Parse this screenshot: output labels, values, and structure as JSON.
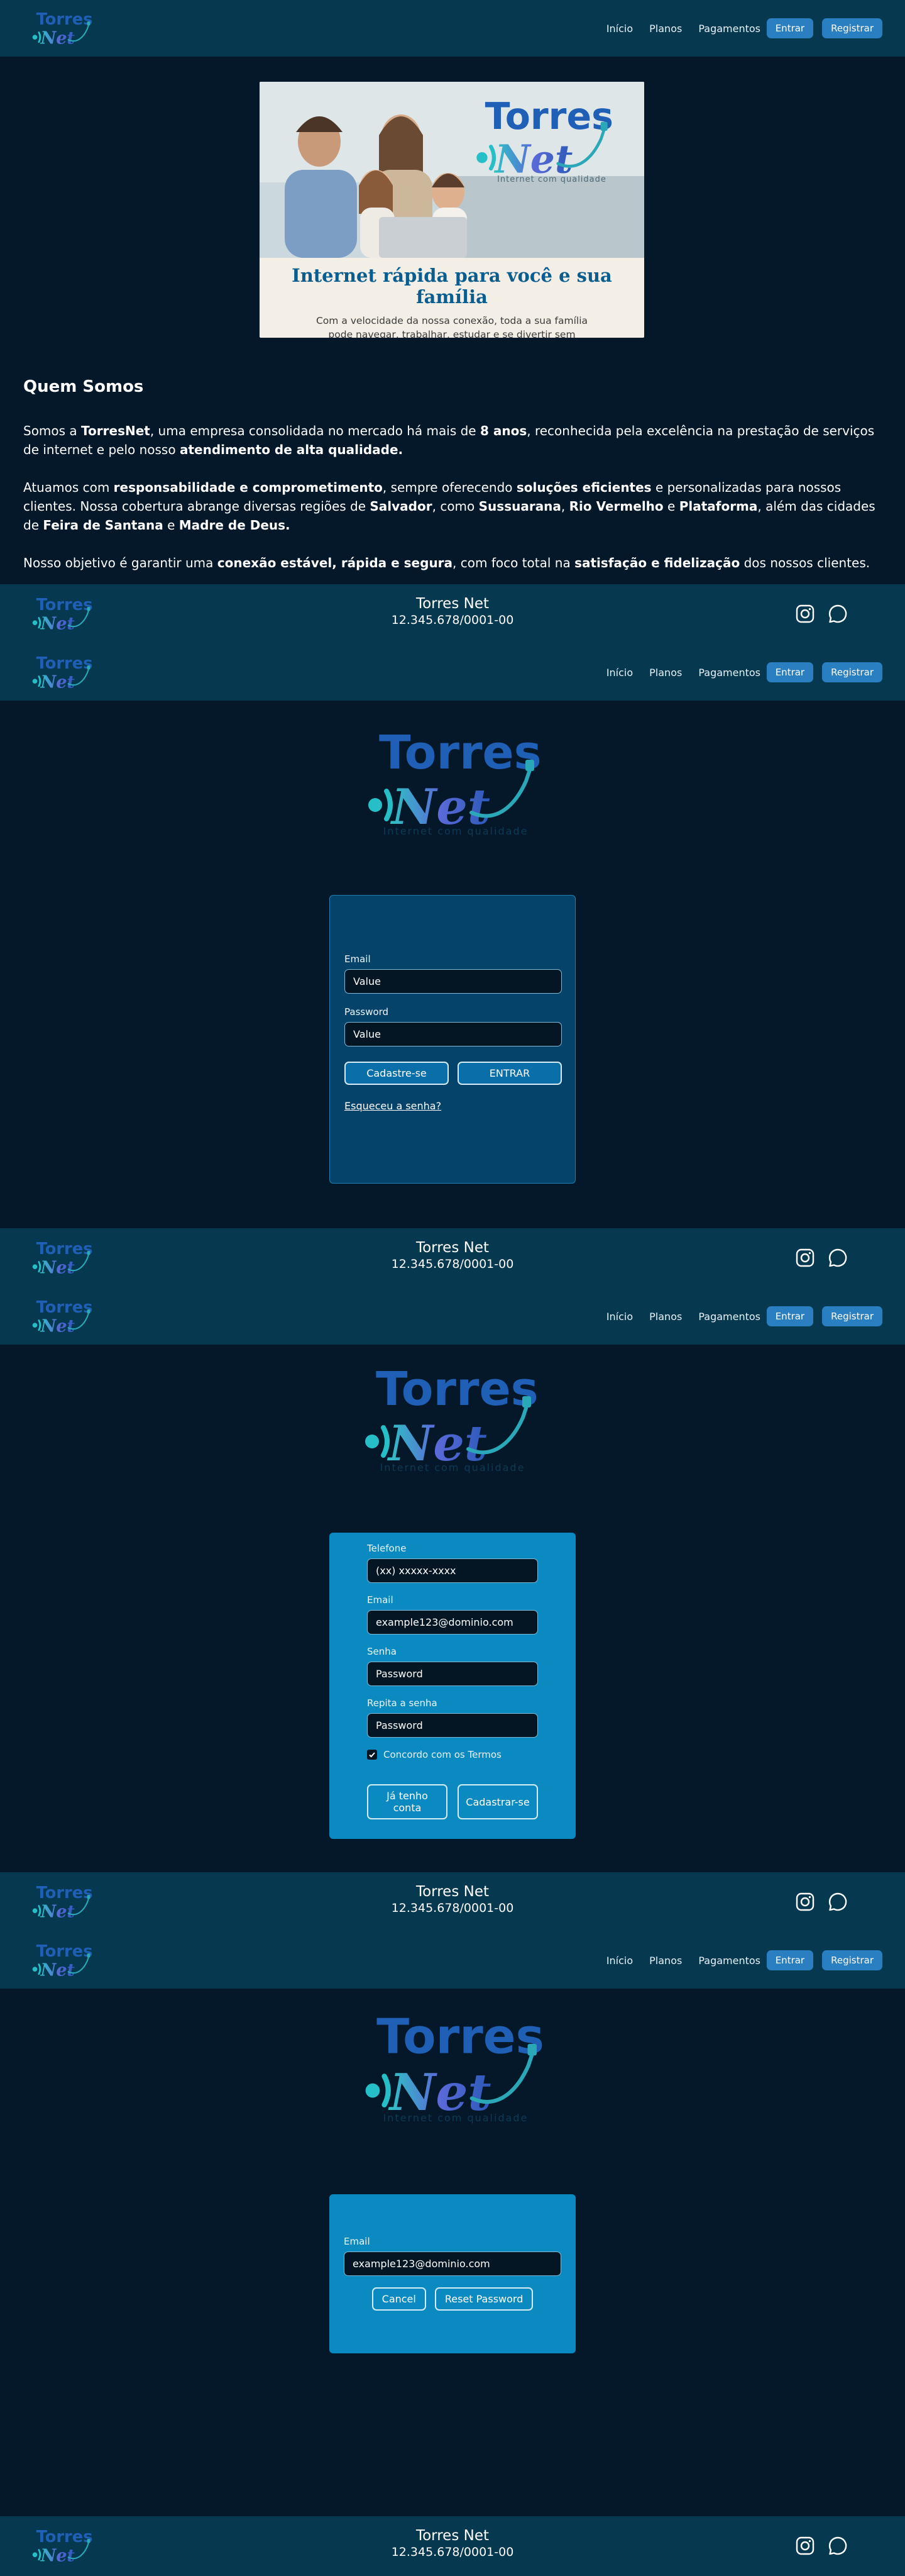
{
  "nav": {
    "links": [
      "Início",
      "Planos",
      "Pagamentos"
    ],
    "login": "Entrar",
    "register": "Registrar"
  },
  "footer": {
    "title": "Torres Net",
    "cnpj": "12.345.678/0001-00",
    "icons": [
      "instagram-icon",
      "whatsapp-icon"
    ]
  },
  "logo": {
    "word1": "Torres",
    "word2": "Net",
    "tagline": "Internet com qualidade"
  },
  "banner": {
    "headline": "Internet rápida para você e sua família",
    "sub": "Com a velocidade da nossa conexão, toda a sua família pode navegar, trabalhar, estudar e se divertir sem interrupções."
  },
  "about": {
    "title": "Quem Somos",
    "p1": [
      {
        "t": "Somos a ",
        "b": false
      },
      {
        "t": "TorresNet",
        "b": true
      },
      {
        "t": ", uma empresa consolidada no mercado há mais de ",
        "b": false
      },
      {
        "t": "8 anos",
        "b": true
      },
      {
        "t": ", reconhecida pela excelência na prestação de serviços de internet e pelo nosso ",
        "b": false
      },
      {
        "t": "atendimento de alta qualidade.",
        "b": true
      }
    ],
    "p2": [
      {
        "t": "Atuamos com ",
        "b": false
      },
      {
        "t": "responsabilidade e comprometimento",
        "b": true
      },
      {
        "t": ", sempre oferecendo ",
        "b": false
      },
      {
        "t": "soluções eficientes",
        "b": true
      },
      {
        "t": " e personalizadas para nossos clientes. Nossa cobertura abrange diversas regiões de ",
        "b": false
      },
      {
        "t": "Salvador",
        "b": true
      },
      {
        "t": ", como ",
        "b": false
      },
      {
        "t": "Sussuarana",
        "b": true
      },
      {
        "t": ", ",
        "b": false
      },
      {
        "t": "Rio Vermelho",
        "b": true
      },
      {
        "t": " e ",
        "b": false
      },
      {
        "t": "Plataforma",
        "b": true
      },
      {
        "t": ", além das cidades de ",
        "b": false
      },
      {
        "t": "Feira de Santana",
        "b": true
      },
      {
        "t": " e ",
        "b": false
      },
      {
        "t": "Madre de Deus.",
        "b": true
      }
    ],
    "p3": [
      {
        "t": "Nosso objetivo é garantir uma ",
        "b": false
      },
      {
        "t": "conexão estável, rápida e segura",
        "b": true
      },
      {
        "t": ", com foco total na ",
        "b": false
      },
      {
        "t": "satisfação e fidelização",
        "b": true
      },
      {
        "t": " dos nossos clientes.",
        "b": false
      }
    ]
  },
  "login": {
    "email_label": "Email",
    "email_value": "Value",
    "password_label": "Password",
    "password_value": "Value",
    "signup": "Cadastre-se",
    "enter": "ENTRAR",
    "forgot": "Esqueceu a senha?"
  },
  "register": {
    "phone_label": "Telefone",
    "phone_placeholder": "(xx) xxxxx-xxxx",
    "email_label": "Email",
    "email_placeholder": "example123@dominio.com",
    "password_label": "Senha",
    "password_placeholder": "Password",
    "repeat_label": "Repita a senha",
    "repeat_placeholder": "Password",
    "terms": "Concordo com os Termos",
    "have_account": "Já tenho conta",
    "submit": "Cadastrar-se"
  },
  "reset": {
    "email_label": "Email",
    "email_value": "example123@dominio.com",
    "cancel": "Cancel",
    "submit": "Reset Password"
  },
  "colors": {
    "page_bg": "#04182a",
    "bar_bg": "#06394f",
    "card_blue": "#0a8ac0",
    "card_dark": "#06436b",
    "button": "#2a7fc0"
  }
}
